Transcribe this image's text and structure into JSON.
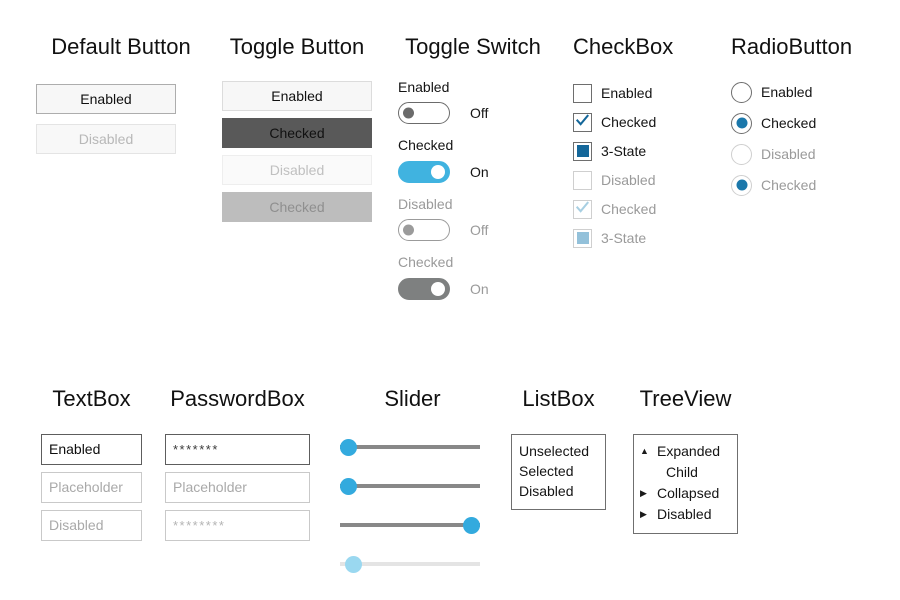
{
  "colors": {
    "accent_switch_on": "#40b3e0",
    "accent_checkbox": "#14679a",
    "accent_checkbox_disabled": "#93c1da",
    "accent_radio": "#1b78ab",
    "accent_slider": "#33aade",
    "accent_slider_disabled": "#9ad8f0",
    "toggle_checked_bg": "#595959",
    "toggle_checked_disabled_bg": "#bdbdbd"
  },
  "columns": {
    "default_button": {
      "title": "Default Button",
      "buttons": [
        {
          "label": "Enabled",
          "state": "enabled"
        },
        {
          "label": "Disabled",
          "state": "disabled"
        }
      ]
    },
    "toggle_button": {
      "title": "Toggle Button",
      "buttons": [
        {
          "label": "Enabled",
          "state": "enabled"
        },
        {
          "label": "Checked",
          "state": "checked"
        },
        {
          "label": "Disabled",
          "state": "disabled"
        },
        {
          "label": "Checked",
          "state": "checked-disabled"
        }
      ]
    },
    "toggle_switch": {
      "title": "Toggle Switch",
      "groups": [
        {
          "header": "Enabled",
          "header_state": "enabled",
          "state_text": "Off",
          "switch": "off",
          "state_text_state": "enabled"
        },
        {
          "header": "Checked",
          "header_state": "enabled",
          "state_text": "On",
          "switch": "on",
          "state_text_state": "enabled"
        },
        {
          "header": "Disabled",
          "header_state": "disabled",
          "state_text": "Off",
          "switch": "off-disabled",
          "state_text_state": "disabled"
        },
        {
          "header": "Checked",
          "header_state": "disabled",
          "state_text": "On",
          "switch": "on-disabled",
          "state_text_state": "disabled"
        }
      ]
    },
    "checkbox": {
      "title": "CheckBox",
      "items": [
        {
          "label": "Enabled",
          "mark": "none",
          "state": "enabled"
        },
        {
          "label": "Checked",
          "mark": "check",
          "state": "enabled"
        },
        {
          "label": "3-State",
          "mark": "fill",
          "state": "enabled"
        },
        {
          "label": "Disabled",
          "mark": "none",
          "state": "disabled"
        },
        {
          "label": "Checked",
          "mark": "check",
          "state": "disabled"
        },
        {
          "label": "3-State",
          "mark": "fill",
          "state": "disabled"
        }
      ]
    },
    "radiobutton": {
      "title": "RadioButton",
      "items": [
        {
          "label": "Enabled",
          "selected": false,
          "state": "enabled"
        },
        {
          "label": "Checked",
          "selected": true,
          "state": "enabled"
        },
        {
          "label": "Disabled",
          "selected": false,
          "state": "disabled"
        },
        {
          "label": "Checked",
          "selected": true,
          "state": "disabled"
        }
      ]
    },
    "textbox": {
      "title": "TextBox",
      "fields": [
        {
          "value": "Enabled",
          "kind": "value",
          "state": "enabled"
        },
        {
          "value": "Placeholder",
          "kind": "placeholder",
          "state": "enabled"
        },
        {
          "value": "Disabled",
          "kind": "placeholder",
          "state": "disabled"
        }
      ]
    },
    "passwordbox": {
      "title": "PasswordBox",
      "fields": [
        {
          "value": "*******",
          "kind": "password",
          "state": "enabled"
        },
        {
          "value": "Placeholder",
          "kind": "placeholder",
          "state": "enabled"
        },
        {
          "value": "********",
          "kind": "password",
          "state": "disabled"
        }
      ]
    },
    "slider": {
      "title": "Slider",
      "sliders": [
        {
          "value": 0,
          "state": "enabled"
        },
        {
          "value": 0,
          "state": "enabled"
        },
        {
          "value": 90,
          "state": "enabled"
        },
        {
          "value": 5,
          "state": "disabled"
        }
      ]
    },
    "listbox": {
      "title": "ListBox",
      "items": [
        {
          "label": "Unselected",
          "state": "enabled"
        },
        {
          "label": "Selected",
          "state": "enabled"
        },
        {
          "label": "Disabled",
          "state": "enabled"
        }
      ]
    },
    "treeview": {
      "title": "TreeView",
      "nodes": [
        {
          "label": "Expanded",
          "arrow": "▲",
          "level": 0,
          "state": "enabled"
        },
        {
          "label": "Child",
          "arrow": "",
          "level": 1,
          "state": "enabled"
        },
        {
          "label": "Collapsed",
          "arrow": "▶",
          "level": 0,
          "state": "enabled"
        },
        {
          "label": "Disabled",
          "arrow": "▶",
          "level": 0,
          "state": "enabled"
        }
      ]
    }
  }
}
